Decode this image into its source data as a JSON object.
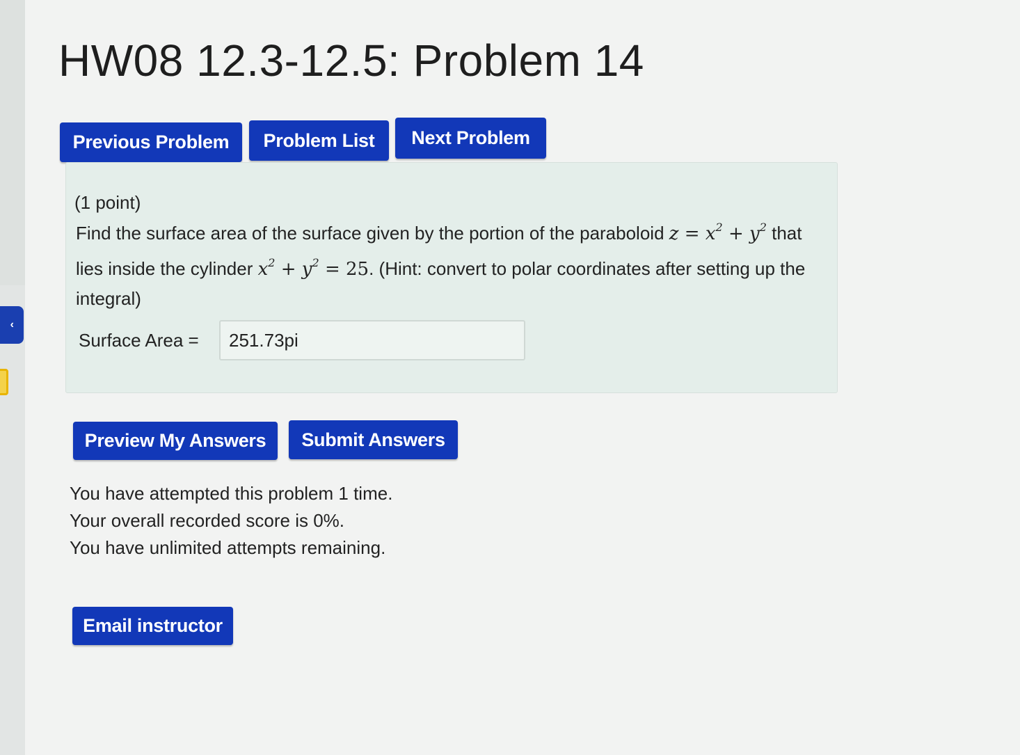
{
  "page": {
    "title": "HW08 12.3-12.5: Problem 14"
  },
  "nav": {
    "previous_label": "Previous Problem",
    "list_label": "Problem List",
    "next_label": "Next Problem"
  },
  "problem": {
    "points": "(1 point)",
    "text_part1": "Find the surface area of the surface given by the portion of the paraboloid",
    "paraboloid_lhs": "z",
    "paraboloid_eq": "=",
    "paraboloid_x": "x",
    "paraboloid_plus": "+",
    "paraboloid_y": "y",
    "exponent": "2",
    "text_part2": "that lies inside the cylinder",
    "cylinder_x": "x",
    "cylinder_plus": "+",
    "cylinder_y": "y",
    "cylinder_eq": "=",
    "cylinder_value": "25",
    "text_part3": ". (Hint: convert to polar coordinates after setting up the integral)",
    "answer_label": "Surface Area =",
    "answer_value": "251.73pi"
  },
  "actions": {
    "preview_label": "Preview My Answers",
    "submit_label": "Submit Answers",
    "email_label": "Email instructor"
  },
  "status": {
    "attempts": "You have attempted this problem 1 time.",
    "score": "Your overall recorded score is 0%.",
    "remaining": "You have unlimited attempts remaining."
  },
  "colors": {
    "button_blue": "#1238b8",
    "problem_box_bg": "#e4eeea",
    "side_tab_yellow": "#f4d24a"
  }
}
